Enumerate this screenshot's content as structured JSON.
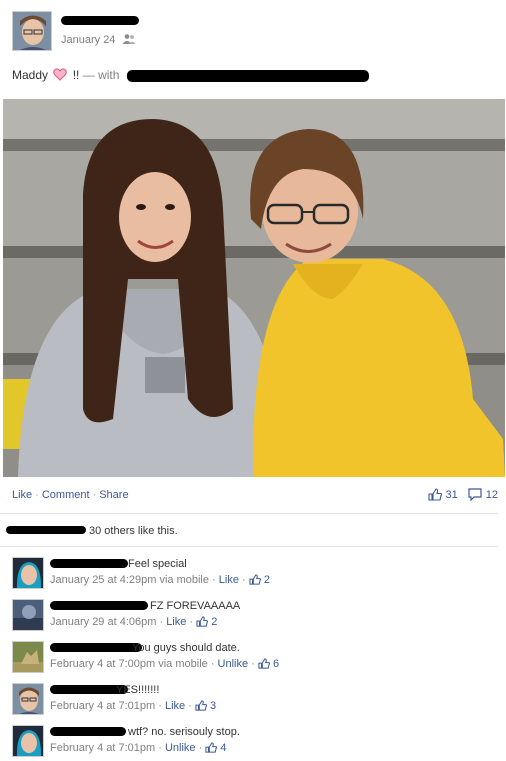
{
  "post": {
    "date": "January 24",
    "caption_text": "Maddy",
    "caption_exclaim": "!!",
    "caption_with": "— with"
  },
  "actions": {
    "like": "Like",
    "comment": "Comment",
    "share": "Share",
    "like_count": "31",
    "comment_count": "12"
  },
  "likes_summary": "30 others like this.",
  "comments": [
    {
      "text": "Feel special",
      "time": "January 25 at 4:29pm",
      "via": "via mobile",
      "action": "Like",
      "likes": "2"
    },
    {
      "text": "FZ FOREVAAAAA",
      "time": "January 29 at 4:06pm",
      "via": "",
      "action": "Like",
      "likes": "2"
    },
    {
      "text": "You guys should date.",
      "time": "February 4 at 7:00pm",
      "via": "via mobile",
      "action": "Unlike",
      "likes": "6"
    },
    {
      "text": "YES!!!!!!!",
      "time": "February 4 at 7:01pm",
      "via": "",
      "action": "Like",
      "likes": "3"
    },
    {
      "text": "wtf? no. serisouly stop.",
      "time": "February 4 at 7:01pm",
      "via": "",
      "action": "Unlike",
      "likes": "4"
    }
  ],
  "colors": {
    "link": "#3b5998",
    "meta": "#7f7f7f",
    "text": "#333333",
    "redaction": "#000000"
  },
  "icons": [
    "friends-icon",
    "heart-icon",
    "like-thumb-icon",
    "comment-bubble-icon"
  ]
}
